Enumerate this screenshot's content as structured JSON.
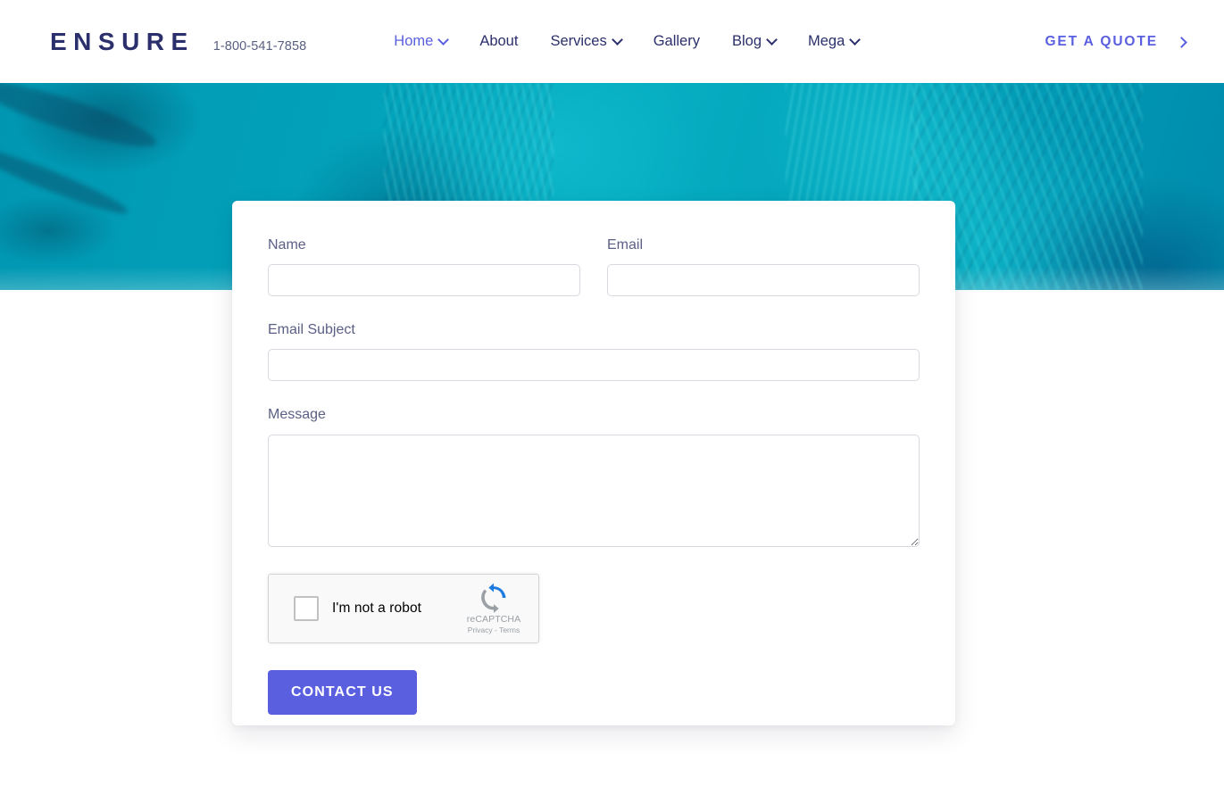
{
  "header": {
    "logo_text": "ENSURE",
    "phone": "1-800-541-7858",
    "nav_items": [
      {
        "label": "Home",
        "has_dropdown": true,
        "active": true
      },
      {
        "label": "About",
        "has_dropdown": false,
        "active": false
      },
      {
        "label": "Services",
        "has_dropdown": true,
        "active": false
      },
      {
        "label": "Gallery",
        "has_dropdown": false,
        "active": false
      },
      {
        "label": "Blog",
        "has_dropdown": true,
        "active": false
      },
      {
        "label": "Mega",
        "has_dropdown": true,
        "active": false
      }
    ],
    "cta_label": "GET A QUOTE",
    "cta_icon": "chevron-right-icon"
  },
  "hero": {
    "image_description": "teal-tinted close-up photo of a woman in a knit sweater",
    "tint_color": "#109fb4"
  },
  "form": {
    "fields": {
      "name": {
        "label": "Name",
        "value": "",
        "placeholder": ""
      },
      "email": {
        "label": "Email",
        "value": "",
        "placeholder": ""
      },
      "subject": {
        "label": "Email Subject",
        "value": "",
        "placeholder": ""
      },
      "message": {
        "label": "Message",
        "value": "",
        "placeholder": ""
      }
    },
    "recaptcha": {
      "checkbox_label": "I'm not a robot",
      "brand_name": "reCAPTCHA",
      "legal": "Privacy - Terms",
      "logo_icon": "recaptcha-logo-icon",
      "checked": false
    },
    "submit_label": "CONTACT US"
  },
  "colors": {
    "accent": "#5a5fe0",
    "navy": "#2b2f6b",
    "teal": "#109fb4",
    "label_gray": "#5b5f85",
    "border": "#d8d8e0"
  }
}
